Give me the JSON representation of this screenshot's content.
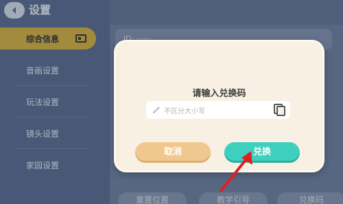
{
  "header": {
    "title": "设置"
  },
  "sidebar": {
    "items": [
      {
        "label": "综合信息",
        "active": true
      },
      {
        "label": "音画设置"
      },
      {
        "label": "玩法设置"
      },
      {
        "label": "镜头设置"
      },
      {
        "label": "家园设置"
      }
    ]
  },
  "main": {
    "info_row": "ID:  ······",
    "bottom_buttons": [
      "重置位置",
      "教学引导",
      "兑换码"
    ]
  },
  "dialog": {
    "title": "请输入兑换码",
    "input_placeholder": "不区分大小写",
    "cancel_label": "取消",
    "confirm_label": "兑换"
  },
  "colors": {
    "cancel": "#f0c88f",
    "confirm": "#3fcfbf",
    "sidebar_active": "#cfac3e",
    "annotation_arrow": "#e02020"
  }
}
